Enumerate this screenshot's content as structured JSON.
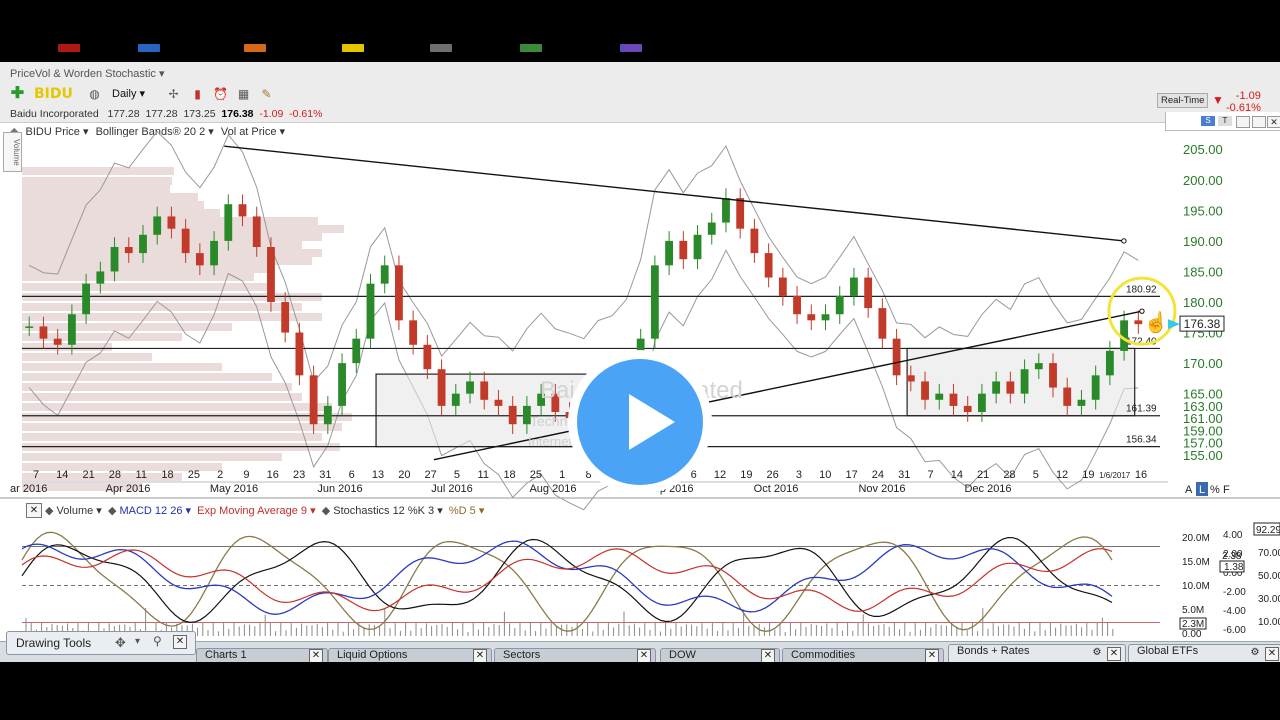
{
  "window": {
    "title": "PriceVol & Worden Stochastic ▾"
  },
  "toolbar": {
    "symbol": "BIDU",
    "interval": "Daily ▾",
    "icons": [
      "add-symbol-icon",
      "broadcast-icon",
      "crosshair-icon",
      "bar-style-icon",
      "alarm-icon",
      "grid-icon",
      "pencil-icon"
    ]
  },
  "quote": {
    "company": "Baidu Incorporated",
    "open": "177.28",
    "high": "177.28",
    "low": "173.25",
    "last": "176.38",
    "change": "-1.09",
    "change_pct": "-0.61%"
  },
  "realtime": {
    "label": "Real-Time",
    "change": "-1.09",
    "change_pct": "-0.61%"
  },
  "overlays": {
    "price": "BIDU Price ▾",
    "bollinger": "Bollinger Bands® 20 2 ▾",
    "vol_at_price": "Vol at Price ▾",
    "volume_tab": "Volume"
  },
  "lower_overlays": {
    "volume": "Volume ▾",
    "macd": "MACD 12 26 ▾",
    "ema": "Exp Moving Average 9 ▾",
    "stochastics": "Stochastics 12 %K 3 ▾",
    "pd": "%D 5 ▾"
  },
  "price_axis": {
    "ticks": [
      "205.00",
      "200.00",
      "195.00",
      "190.00",
      "185.00",
      "180.00",
      "175.00",
      "170.00",
      "165.00",
      "163.00",
      "161.00",
      "159.00",
      "157.00",
      "155.00"
    ],
    "current": "176.38"
  },
  "levels": [
    {
      "label": "180.92",
      "value": 180.92
    },
    {
      "label": "172.40",
      "value": 172.4
    },
    {
      "label": "161.39",
      "value": 161.39
    },
    {
      "label": "156.34",
      "value": 156.34
    }
  ],
  "date_axis": {
    "days": [
      "7",
      "14",
      "21",
      "28",
      "11",
      "18",
      "25",
      "2",
      "9",
      "16",
      "23",
      "31",
      "6",
      "13",
      "20",
      "27",
      "5",
      "11",
      "18",
      "25",
      "1",
      "8",
      "15",
      "22",
      "29",
      "6",
      "12",
      "19",
      "26",
      "3",
      "10",
      "17",
      "24",
      "31",
      "7",
      "14",
      "21",
      "28",
      "5",
      "12",
      "19",
      "1/6/2017",
      "16"
    ],
    "months": [
      "ar 2016",
      "Apr 2016",
      "May 2016",
      "Jun 2016",
      "Jul 2016",
      "Aug 2016",
      "Sep 2016",
      "Oct 2016",
      "Nov 2016",
      "Dec 2016"
    ],
    "scale_buttons": [
      "A",
      "L",
      "%",
      "F"
    ]
  },
  "indicator_axis": {
    "volume_ticks": [
      "20.0M",
      "15.0M",
      "10.0M",
      "5.0M",
      "0.00"
    ],
    "macd_ticks": [
      "4.00",
      "2.00",
      "0.00",
      "-2.00",
      "-4.00",
      "-6.00"
    ],
    "stoch_ticks": [
      "70.00",
      "50.00",
      "30.00",
      "10.00"
    ],
    "macd_value": "2.38",
    "macd_box": "1.38",
    "volume_box": "2.3M",
    "stoch_top": "92.29"
  },
  "watermark": {
    "name": "Baidu Incorporated",
    "sector": "Technology Sector(S)",
    "industry": "Internet Content & Information"
  },
  "bottom": {
    "drawing_tools": "Drawing Tools",
    "tabs": [
      "Charts 1",
      "Liquid Options",
      "Sectors",
      "DOW",
      "Commodities",
      "Bonds + Rates",
      "Global ETFs"
    ]
  },
  "chart_data": {
    "type": "candlestick",
    "symbol": "BIDU",
    "interval": "Daily",
    "ylim": [
      153,
      207
    ],
    "x_range": [
      "2016-03-07",
      "2017-01-16"
    ],
    "indicators": [
      "Bollinger Bands 20 2",
      "Vol at Price",
      "Volume",
      "MACD 12 26",
      "Exp Moving Average 9",
      "Stochastics 12 %K 3",
      "%D 5"
    ],
    "horizontal_levels": [
      180.92,
      172.4,
      161.39,
      156.34
    ],
    "trendlines": [
      {
        "name": "resistance",
        "from": [
          "2016-05-02",
          205.5
        ],
        "to": [
          "2017-01-06",
          190.0
        ]
      },
      {
        "name": "support",
        "from": [
          "2016-06-29",
          154.2
        ],
        "to": [
          "2017-01-11",
          178.5
        ]
      }
    ],
    "ranges": [
      {
        "start": "2016-06-13",
        "end": "2016-08-12",
        "low": 156.34,
        "high": 168.2
      },
      {
        "start": "2016-11-07",
        "end": "2017-01-09",
        "low": 161.39,
        "high": 172.4
      }
    ],
    "close_series": [
      176,
      174,
      173,
      178,
      183,
      185,
      189,
      188,
      191,
      194,
      192,
      188,
      186,
      190,
      196,
      194,
      189,
      180,
      175,
      168,
      160,
      163,
      170,
      174,
      183,
      186,
      177,
      173,
      169,
      163,
      165,
      167,
      164,
      163,
      160,
      163,
      165,
      162,
      161,
      160,
      163,
      164,
      167,
      174,
      186,
      190,
      187,
      191,
      193,
      197,
      192,
      188,
      184,
      181,
      178,
      177,
      178,
      181,
      184,
      179,
      174,
      168,
      167,
      164,
      165,
      163,
      162,
      165,
      167,
      165,
      169,
      170,
      166,
      163,
      164,
      168,
      172,
      177,
      176.38
    ],
    "last": 176.38
  }
}
